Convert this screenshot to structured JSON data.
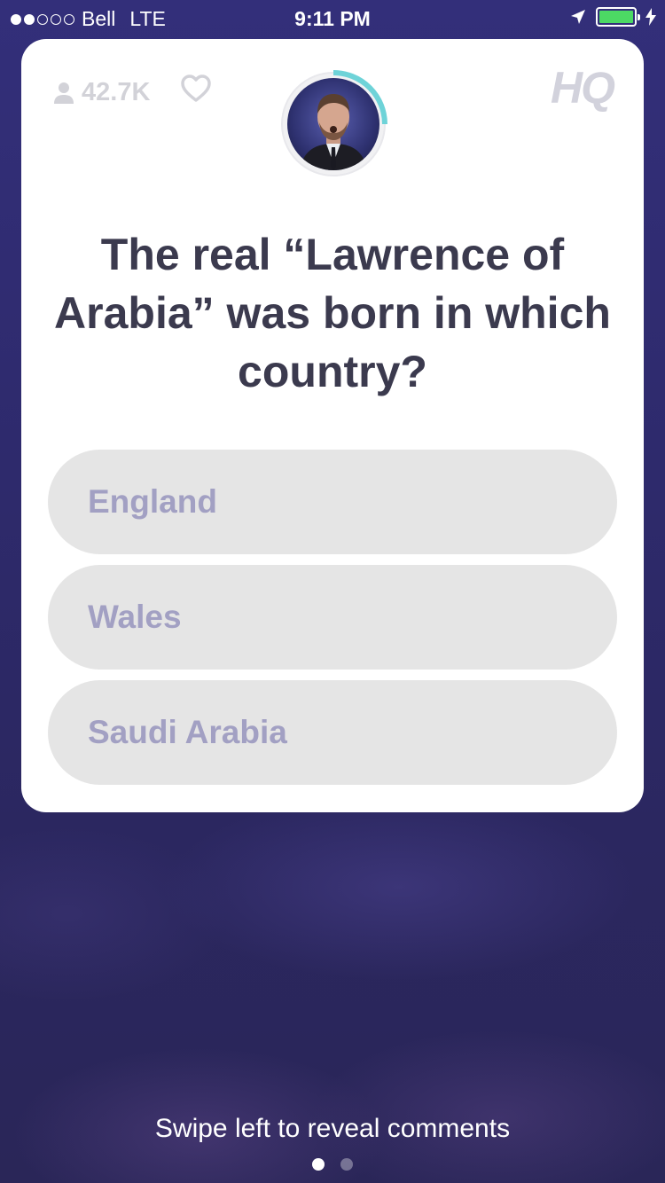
{
  "status_bar": {
    "signal_dots_filled": 2,
    "signal_dots_total": 5,
    "carrier": "Bell",
    "network": "LTE",
    "time": "9:11 PM",
    "battery_color": "#4cd964",
    "location_icon": "location-arrow-icon",
    "charging_icon": "bolt-icon"
  },
  "card": {
    "viewer_count": "42.7K",
    "viewer_icon": "person-icon",
    "heart_icon": "heart-icon",
    "logo": "HQ",
    "host_timer_color": "#6ed3d8",
    "timer_progress": 0.25,
    "question": "The real “Lawrence of Arabia” was born in which country?",
    "answers": [
      {
        "label": "England"
      },
      {
        "label": "Wales"
      },
      {
        "label": "Saudi Arabia"
      }
    ]
  },
  "footer": {
    "swipe_hint": "Swipe left to reveal comments",
    "page_count": 2,
    "active_page": 1
  },
  "colors": {
    "background": "#2e2a6c",
    "card": "#ffffff",
    "answer_bg": "#e5e5e5",
    "answer_text": "#a2a0c3",
    "question_text": "#3b3a4e"
  }
}
